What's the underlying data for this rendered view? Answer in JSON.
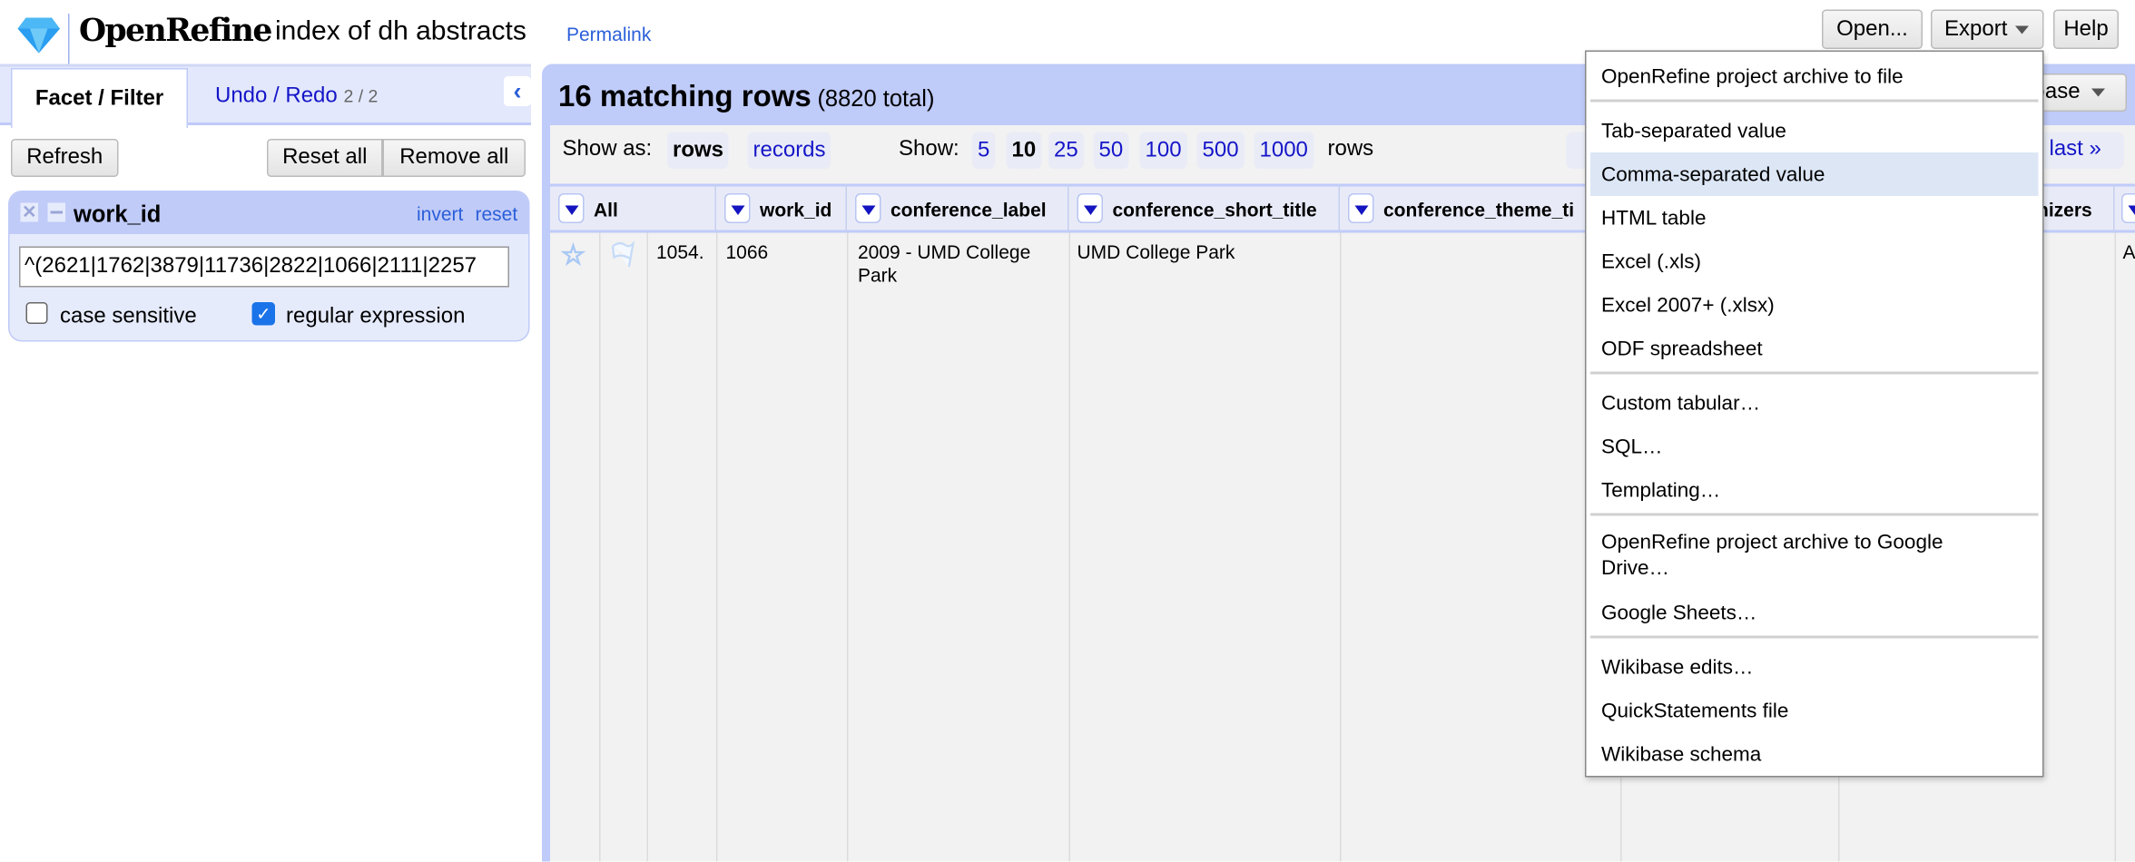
{
  "header": {
    "app_name": "OpenRefine",
    "project_title": "index of dh abstracts",
    "permalink": "Permalink",
    "buttons": {
      "open": "Open...",
      "export": "Export",
      "help": "Help"
    }
  },
  "left_panel": {
    "tabs": {
      "facet_filter": "Facet / Filter",
      "undo_redo": "Undo / Redo",
      "undo_redo_count": "2 / 2"
    },
    "refresh": "Refresh",
    "reset_all": "Reset all",
    "remove_all": "Remove all",
    "facet": {
      "title": "work_id",
      "invert": "invert",
      "reset": "reset",
      "value": "^(2621|1762|3879|11736|2822|1066|2111|2257",
      "case_sensitive": {
        "label": "case sensitive",
        "checked": false
      },
      "regular_expression": {
        "label": "regular expression",
        "checked": true
      }
    }
  },
  "main": {
    "count": "16 matching rows",
    "total": "(8820 total)",
    "show_as_label": "Show as:",
    "show_as": [
      "rows",
      "records"
    ],
    "show_as_selected": "rows",
    "show_label": "Show:",
    "page_sizes": [
      "5",
      "10",
      "25",
      "50",
      "100",
      "500",
      "1000"
    ],
    "page_size_selected": "10",
    "rows_word": "rows",
    "last": "last »",
    "extension_button": "base",
    "columns": [
      "All",
      "work_id",
      "conference_label",
      "conference_short_title",
      "conference_theme_ti",
      "",
      "nizers",
      ""
    ],
    "rows": [
      {
        "row_number": "1054.",
        "work_id": "1066",
        "conference_label": "2009 - UMD College Park",
        "conference_short_title": "UMD College Park",
        "last_col": "A"
      }
    ]
  },
  "export_menu": {
    "items": [
      [
        "OpenRefine project archive to file"
      ],
      [
        "Tab-separated value",
        "Comma-separated value",
        "HTML table",
        "Excel (.xls)",
        "Excel 2007+ (.xlsx)",
        "ODF spreadsheet"
      ],
      [
        "Custom tabular…",
        "SQL…",
        "Templating…"
      ],
      [
        "OpenRefine project archive to Google Drive…",
        "Google Sheets…"
      ],
      [
        "Wikibase edits…",
        "QuickStatements file",
        "Wikibase schema"
      ]
    ],
    "highlighted": "Comma-separated value"
  },
  "colors": {
    "accent_blue": "#bfcbf9",
    "link": "#1515c8",
    "menu_highlight": "#dce6f5"
  }
}
